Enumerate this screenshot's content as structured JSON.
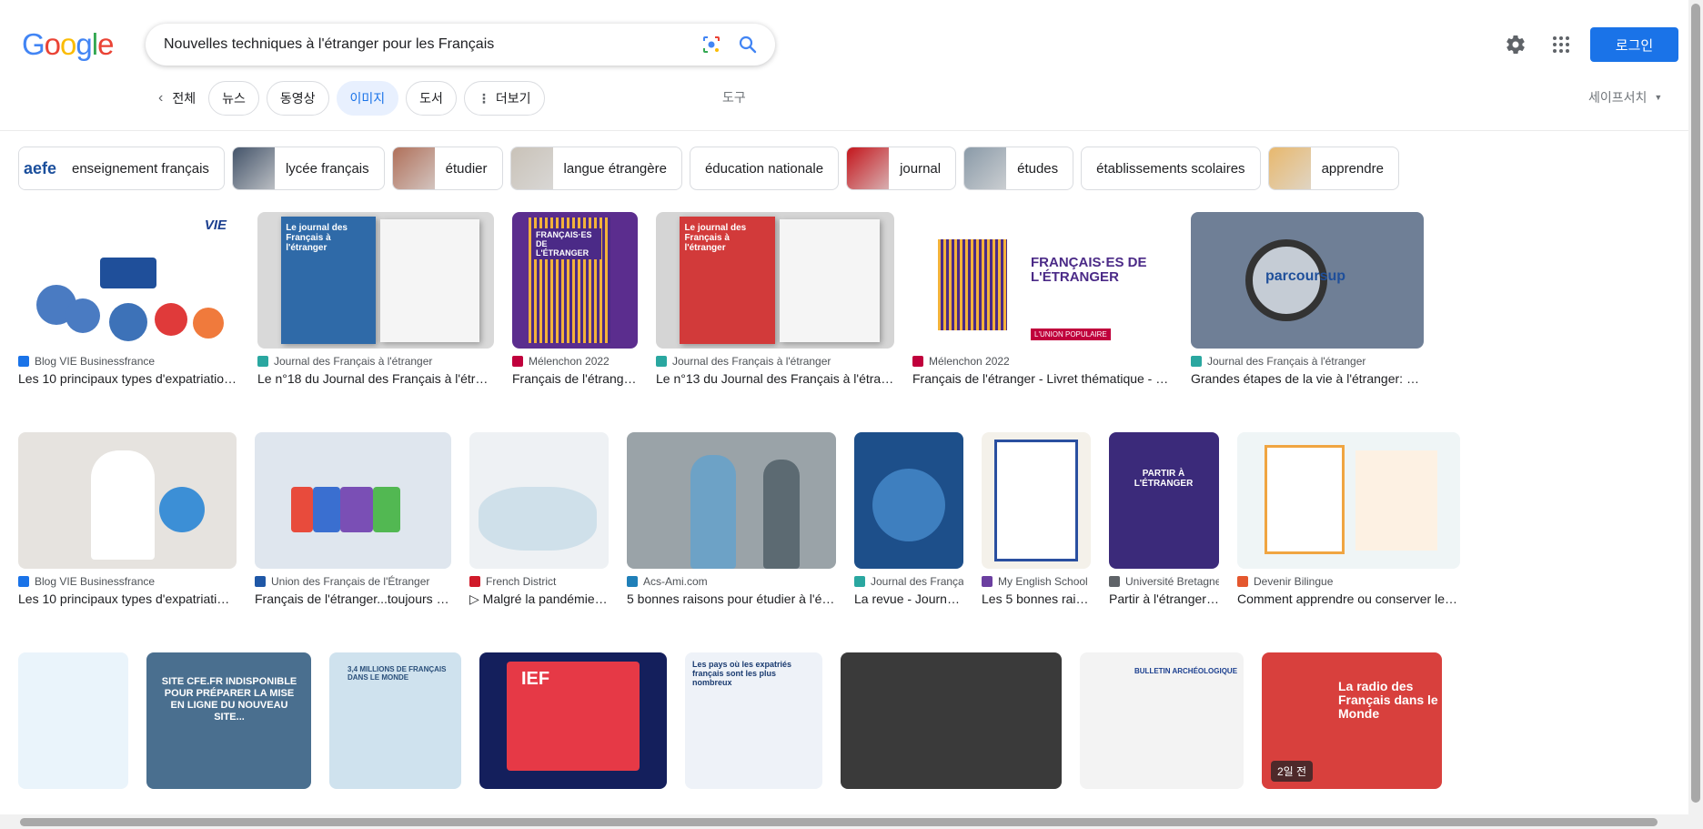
{
  "logo": {
    "letters": [
      "G",
      "o",
      "o",
      "g",
      "l",
      "e"
    ],
    "colors": [
      "#4285f4",
      "#ea4335",
      "#fbbc05",
      "#4285f4",
      "#34a853",
      "#ea4335"
    ]
  },
  "search": {
    "query": "Nouvelles techniques à l'étranger pour les Français"
  },
  "header": {
    "login_label": "로그인"
  },
  "tabs": [
    {
      "label": "전체",
      "active": false
    },
    {
      "label": "뉴스",
      "active": false
    },
    {
      "label": "동영상",
      "active": false
    },
    {
      "label": "이미지",
      "active": true
    },
    {
      "label": "도서",
      "active": false
    },
    {
      "label": "더보기",
      "active": false
    }
  ],
  "tools_label": "도구",
  "safesearch_label": "세이프서치",
  "chips": [
    {
      "label": "enseignement français",
      "thumb": "aefe"
    },
    {
      "label": "lycée français",
      "thumb": "#44546a"
    },
    {
      "label": "étudier",
      "thumb": "#b0705a"
    },
    {
      "label": "langue étrangère",
      "thumb": "#c9c2b8"
    },
    {
      "label": "éducation nationale",
      "thumb": ""
    },
    {
      "label": "journal",
      "thumb": "#c4161c"
    },
    {
      "label": "études",
      "thumb": "#8a9aa8"
    },
    {
      "label": "établissements scolaires",
      "thumb": ""
    },
    {
      "label": "apprendre",
      "thumb": "#e8b86d"
    }
  ],
  "row1": [
    {
      "source": "Blog VIE Businessfrance",
      "title": "Les 10 principaux types d'expatriation pour ...",
      "icon": "#1a73e8",
      "bg": "#ffffff"
    },
    {
      "source": "Journal des Français à l'étranger",
      "title": "Le n°18 du Journal des Français à l'étranger est ...",
      "icon": "#2aa7a0",
      "bg": "#d9d9d9"
    },
    {
      "source": "Mélenchon 2022",
      "title": "Français de l'étranger - ...",
      "icon": "#c0003c",
      "bg": "#5b2d8e"
    },
    {
      "source": "Journal des Français à l'étranger",
      "title": "Le n°13 du Journal des Français à l'étranger est ...",
      "icon": "#2aa7a0",
      "bg": "#d5d5d5"
    },
    {
      "source": "Mélenchon 2022",
      "title": "Français de l'étranger - Livret thématique - Mélenc...",
      "icon": "#c0003c",
      "bg": "#ffffff"
    },
    {
      "source": "Journal des Français à l'étranger",
      "title": "Grandes étapes de la vie à l'étranger: quelles ...",
      "icon": "#2aa7a0",
      "bg": "#6f7f96"
    }
  ],
  "row2": [
    {
      "source": "Blog VIE Businessfrance",
      "title": "Les 10 principaux types d'expatriation pour ...",
      "icon": "#1a73e8",
      "bg": "#e6e3df"
    },
    {
      "source": "Union des Français de l'Étranger",
      "title": "Français de l'étranger...toujours plus ...",
      "icon": "#1f57a6",
      "bg": "#dfe6ee"
    },
    {
      "source": "French District",
      "title": "▷ Malgré la pandémie, le ...",
      "icon": "#d01a2a",
      "bg": "#eef1f4"
    },
    {
      "source": "Acs-Ami.com",
      "title": "5 bonnes raisons pour étudier à l'étranger",
      "icon": "#1f7fb8",
      "bg": "#9aa3a8"
    },
    {
      "source": "Journal des Françai...",
      "title": "La revue - Journal d...",
      "icon": "#2aa7a0",
      "bg": "#1d4f8a"
    },
    {
      "source": "My English School",
      "title": "Les 5 bonnes raiso...",
      "icon": "#6b3fa0",
      "bg": "#f4f1ea"
    },
    {
      "source": "Université Bretagne ...",
      "title": "Partir à l'étranger - ...",
      "icon": "#5f6368",
      "bg": "#3b2a7a"
    },
    {
      "source": "Devenir Bilingue",
      "title": "Comment apprendre ou conserver le f...",
      "icon": "#e4572e",
      "bg": "#eff5f6"
    }
  ],
  "row3": [
    {
      "bg": "#eaf4fb",
      "badge": ""
    },
    {
      "bg": "#4a6f8f",
      "badge": ""
    },
    {
      "bg": "#cfe2ee",
      "badge": ""
    },
    {
      "bg": "#141f5c",
      "badge": ""
    },
    {
      "bg": "#eef2f8",
      "badge": ""
    },
    {
      "bg": "#3a3a3a",
      "badge": ""
    },
    {
      "bg": "#f3f3f3",
      "badge": ""
    },
    {
      "bg": "#d8403d",
      "badge": "2일 전"
    }
  ],
  "art": {
    "vie": "VIE",
    "jfe": "Le journal des Français à l'étranger",
    "mel": "FRANÇAIS·ES DE L'ÉTRANGER",
    "mel_footer": "L'UNION POPULAIRE",
    "parcoursup": "parcoursup",
    "ief": "IEF",
    "cfe": "SITE CFE.FR INDISPONIBLE POUR PRÉPARER LA MISE EN LIGNE DU NOUVEAU SITE...",
    "map": "3,4 MILLIONS DE FRANÇAIS DANS LE MONDE",
    "statista": "Les pays où les expatriés français sont les plus nombreux",
    "radio": "La radio des Français dans le Monde",
    "partir": "PARTIR À L'ÉTRANGER",
    "bulletin": "BULLETIN ARCHÉOLOGIQUE"
  }
}
